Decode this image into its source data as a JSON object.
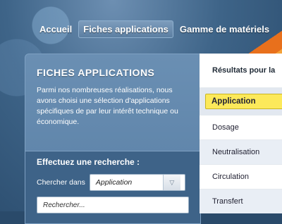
{
  "nav": {
    "items": [
      "Accueil",
      "Fiches applications",
      "Gamme de matériels"
    ]
  },
  "panel": {
    "title": "FICHES APPLICATIONS",
    "description": "Parmi nos nombreuses réalisations, nous avons choisi une sélection d'applications spécifiques de par leur intérêt technique ou économique."
  },
  "search": {
    "title": "Effectuez une recherche :",
    "field_label": "Chercher dans",
    "selected": "Application",
    "placeholder": "Rechercher..."
  },
  "results": {
    "title": "Résultats pour la",
    "header": "Application",
    "rows": [
      "Dosage",
      "Neutralisation",
      "Circulation",
      "Transfert"
    ]
  },
  "colors": {
    "highlight": "#fce95a",
    "accent_stripe": "#e8701c"
  }
}
